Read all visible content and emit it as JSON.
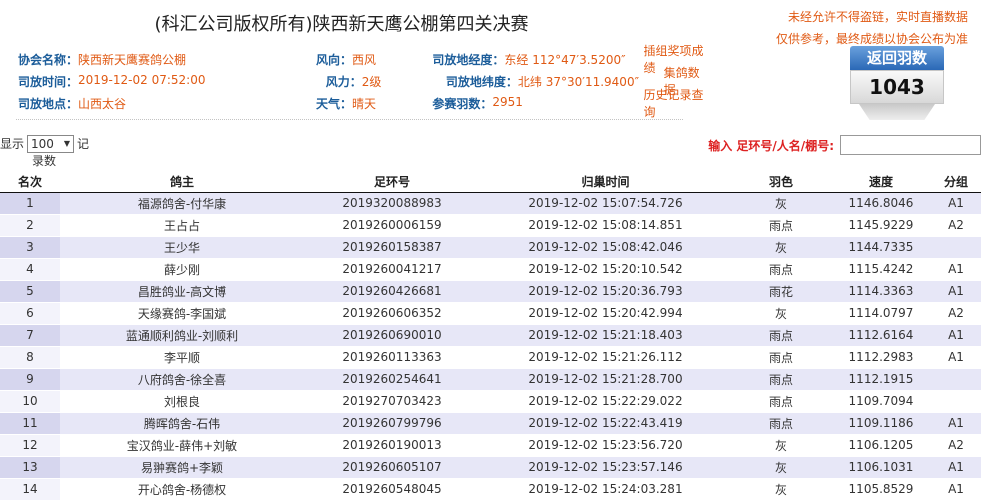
{
  "title": "(科汇公司版权所有)陕西新天鹰公棚第四关决赛",
  "notice": [
    "未经允许不得盗链，实时直播数据",
    "仅供参考，最终成绩以协会公布为准"
  ],
  "info": [
    [
      {
        "label": "协会名称：",
        "value": "陕西新天鹰赛鸽公棚"
      },
      {
        "label": "风向：",
        "value": "西风"
      },
      {
        "label": "司放地经度：",
        "value": "东经 112°47′3.5200″",
        "link": "插组奖项成绩"
      }
    ],
    [
      {
        "label": "司放时间：",
        "value": "2019-12-02 07:52:00"
      },
      {
        "label": "风力：",
        "value": "2级"
      },
      {
        "label": "司放地纬度：",
        "value": "北纬 37°30′11.9400″",
        "link": "集鸽数据"
      }
    ],
    [
      {
        "label": "司放地点：",
        "value": "山西太谷"
      },
      {
        "label": "天气：",
        "value": "晴天"
      },
      {
        "label": "参赛羽数：",
        "value": "2951",
        "link": "历史记录查询"
      }
    ]
  ],
  "return_box": {
    "label": "返回羽数",
    "count": "1043"
  },
  "show": {
    "prefix": "显示",
    "selected": "100",
    "suffix": "记",
    "suffix2": "录数"
  },
  "search": {
    "label": "输入 足环号/人名/棚号:",
    "value": ""
  },
  "columns": [
    "名次",
    "鸽主",
    "足环号",
    "归巢时间",
    "羽色",
    "速度",
    "分组"
  ],
  "rows": [
    [
      "1",
      "福源鸽舍-付华康",
      "2019320088983",
      "2019-12-02 15:07:54.726",
      "灰",
      "1146.8046",
      "A1"
    ],
    [
      "2",
      "王占占",
      "2019260006159",
      "2019-12-02 15:08:14.851",
      "雨点",
      "1145.9229",
      "A2"
    ],
    [
      "3",
      "王少华",
      "2019260158387",
      "2019-12-02 15:08:42.046",
      "灰",
      "1144.7335",
      ""
    ],
    [
      "4",
      "薛少刚",
      "2019260041217",
      "2019-12-02 15:20:10.542",
      "雨点",
      "1115.4242",
      "A1"
    ],
    [
      "5",
      "昌胜鸽业-高文博",
      "2019260426681",
      "2019-12-02 15:20:36.793",
      "雨花",
      "1114.3363",
      "A1"
    ],
    [
      "6",
      "天缘赛鸽-李国斌",
      "2019260606352",
      "2019-12-02 15:20:42.994",
      "灰",
      "1114.0797",
      "A2"
    ],
    [
      "7",
      "蓝通顺利鸽业-刘顺利",
      "2019260690010",
      "2019-12-02 15:21:18.403",
      "雨点",
      "1112.6164",
      "A1"
    ],
    [
      "8",
      "李平顺",
      "2019260113363",
      "2019-12-02 15:21:26.112",
      "雨点",
      "1112.2983",
      "A1"
    ],
    [
      "9",
      "八府鸽舍-徐全喜",
      "2019260254641",
      "2019-12-02 15:21:28.700",
      "雨点",
      "1112.1915",
      ""
    ],
    [
      "10",
      "刘根良",
      "2019270703423",
      "2019-12-02 15:22:29.022",
      "雨点",
      "1109.7094",
      ""
    ],
    [
      "11",
      "腾晖鸽舍-石伟",
      "2019260799796",
      "2019-12-02 15:22:43.419",
      "雨点",
      "1109.1186",
      "A1"
    ],
    [
      "12",
      "宝汉鸽业-薛伟+刘敏",
      "2019260190013",
      "2019-12-02 15:23:56.720",
      "灰",
      "1106.1205",
      "A2"
    ],
    [
      "13",
      "易翀赛鸽+李颖",
      "2019260605107",
      "2019-12-02 15:23:57.146",
      "灰",
      "1106.1031",
      "A1"
    ],
    [
      "14",
      "开心鸽舍-杨德权",
      "2019260548045",
      "2019-12-02 15:24:03.281",
      "灰",
      "1105.8529",
      "A1"
    ]
  ]
}
